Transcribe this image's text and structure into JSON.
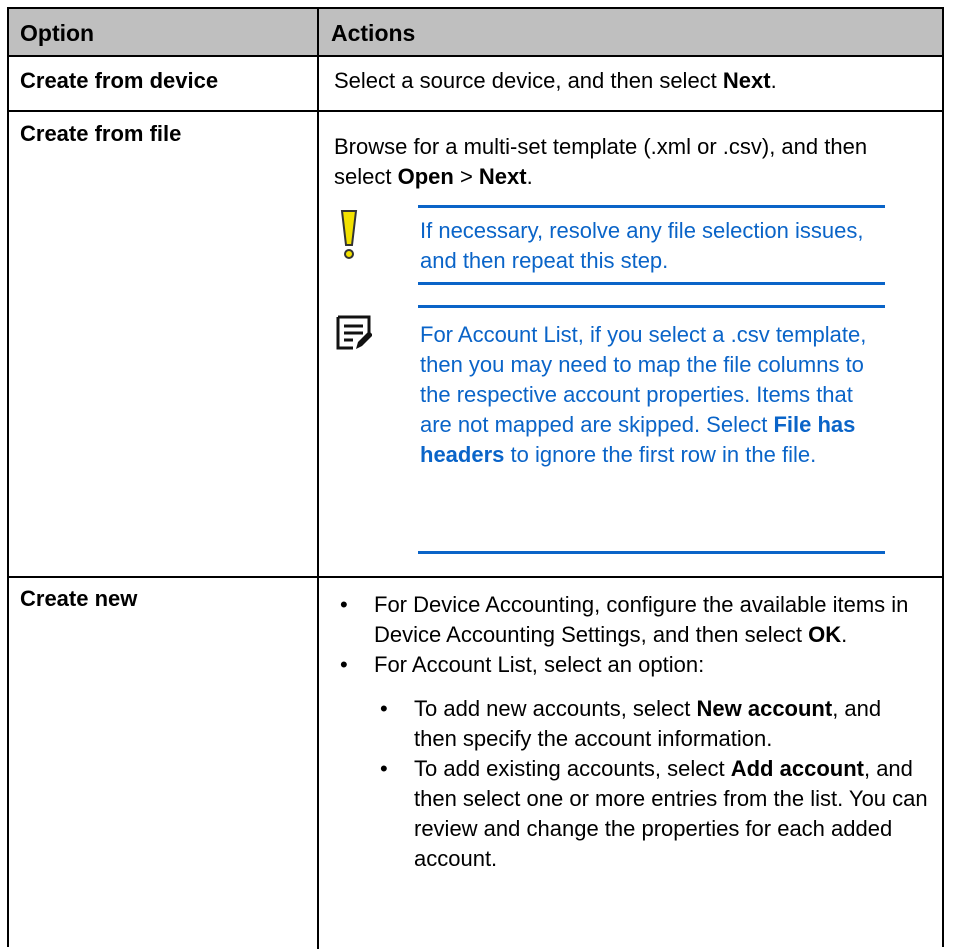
{
  "header": {
    "option": "Option",
    "actions": "Actions"
  },
  "rows": [
    {
      "option": "Create from device",
      "action": {
        "pre": "Select a source device, and then select ",
        "bold": "Next",
        "post": "."
      }
    },
    {
      "option": "Create from file",
      "action": {
        "pre": "Browse for a multi-set template (.xml or .csv), and then select ",
        "bold1": "Open",
        "mid": " > ",
        "bold2": "Next",
        "post": "."
      },
      "caution": {
        "icon": "caution-icon",
        "text": "If necessary, resolve any file selection issues, and then repeat this step."
      },
      "note": {
        "icon": "note-icon",
        "pre": "For Account List, if you select a .csv template, then you may need to map the file columns to the respective account properties. Items that are not mapped are skipped. Select ",
        "bold": "File has headers",
        "post": " to ignore the first row in the file."
      }
    },
    {
      "option": "Create new",
      "bullets": [
        {
          "pre": "For Device Accounting, configure the available items in Device Accounting Settings, and then select ",
          "bold": "OK",
          "post": "."
        },
        {
          "pre": "For Account List, select an option:"
        }
      ],
      "subbullets": [
        {
          "pre": "To add new accounts, select ",
          "bold": "New account",
          "post": ", and then specify the account information."
        },
        {
          "pre": "To add existing accounts, select ",
          "bold": "Add account",
          "post": ", and then select one or more entries from the list. You can review and change the properties for each added account."
        }
      ]
    }
  ],
  "colors": {
    "header_bg": "#bfbfbf",
    "note_blue": "#0a64c8",
    "caution_yellow": "#f2e100"
  }
}
